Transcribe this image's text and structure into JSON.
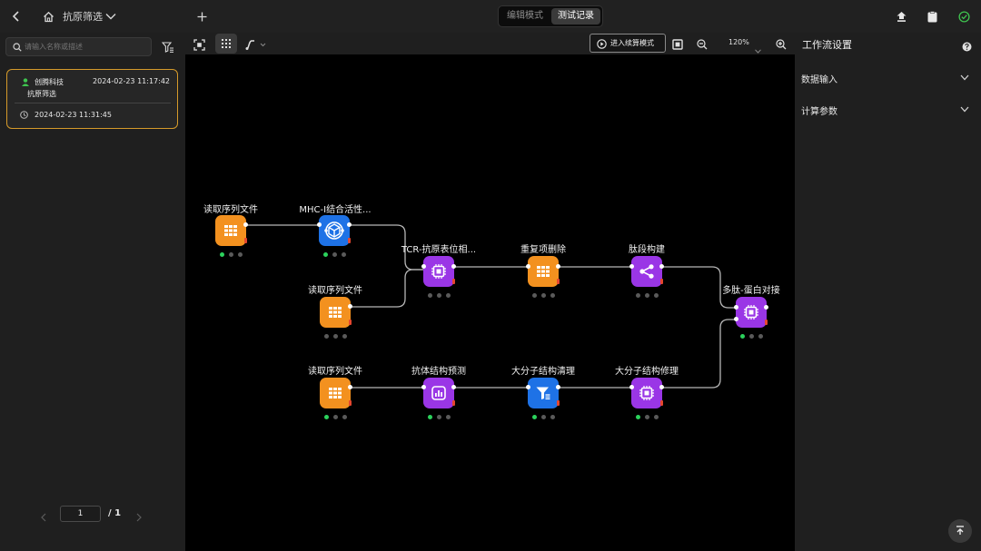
{
  "topbar": {
    "title": "抗原筛选",
    "mode_edit": "编辑模式",
    "mode_test": "测试记录"
  },
  "sidebar": {
    "search_placeholder": "请输入名称或描述",
    "record": {
      "user": "创腾科技",
      "datetime": "2024-02-23 11:17:42",
      "name": "抗原筛选",
      "time": "2024-02-23 11:31:45"
    },
    "pagination": {
      "current": "1",
      "total": "/ 1"
    }
  },
  "canvas_toolbar": {
    "continue_mode_label": "进入续算模式",
    "zoom": "120%"
  },
  "right_panel": {
    "title": "工作流设置",
    "sections": [
      "数据输入",
      "计算参数"
    ]
  },
  "nodes": [
    {
      "label": "读取序列文件",
      "color": "orange",
      "icon": "grid-icon",
      "status": [
        true,
        false,
        false
      ]
    },
    {
      "label": "MHC-I结合活性...",
      "color": "blue",
      "icon": "molecule-icon",
      "status": [
        true,
        false,
        false
      ]
    },
    {
      "label": "读取序列文件",
      "color": "orange",
      "icon": "grid-icon",
      "status": [
        false,
        false,
        false
      ]
    },
    {
      "label": "TCR-抗原表位相...",
      "color": "purple",
      "icon": "chip-icon",
      "status": [
        false,
        false,
        false
      ]
    },
    {
      "label": "重复项删除",
      "color": "orange",
      "icon": "grid-icon",
      "status": [
        false,
        false,
        false
      ]
    },
    {
      "label": "肽段构建",
      "color": "purple",
      "icon": "share-icon",
      "status": [
        false,
        false,
        false
      ]
    },
    {
      "label": "多肽-蛋白对接",
      "color": "purple",
      "icon": "chip-icon",
      "status": [
        true,
        false,
        false
      ]
    },
    {
      "label": "读取序列文件",
      "color": "orange",
      "icon": "grid-icon",
      "status": [
        true,
        false,
        false
      ]
    },
    {
      "label": "抗体结构预测",
      "color": "purple",
      "icon": "chart-icon",
      "status": [
        true,
        false,
        false
      ]
    },
    {
      "label": "大分子结构清理",
      "color": "blue",
      "icon": "filter-icon",
      "status": [
        true,
        false,
        false
      ]
    },
    {
      "label": "大分子结构修理",
      "color": "purple",
      "icon": "chip-icon",
      "status": [
        true,
        false,
        false
      ]
    }
  ],
  "colors": {
    "orange": "#f3911f",
    "purple": "#9a36e6",
    "blue": "#1e72e6",
    "status_active": "#2bd25c",
    "record_border": "#d59a2a"
  }
}
